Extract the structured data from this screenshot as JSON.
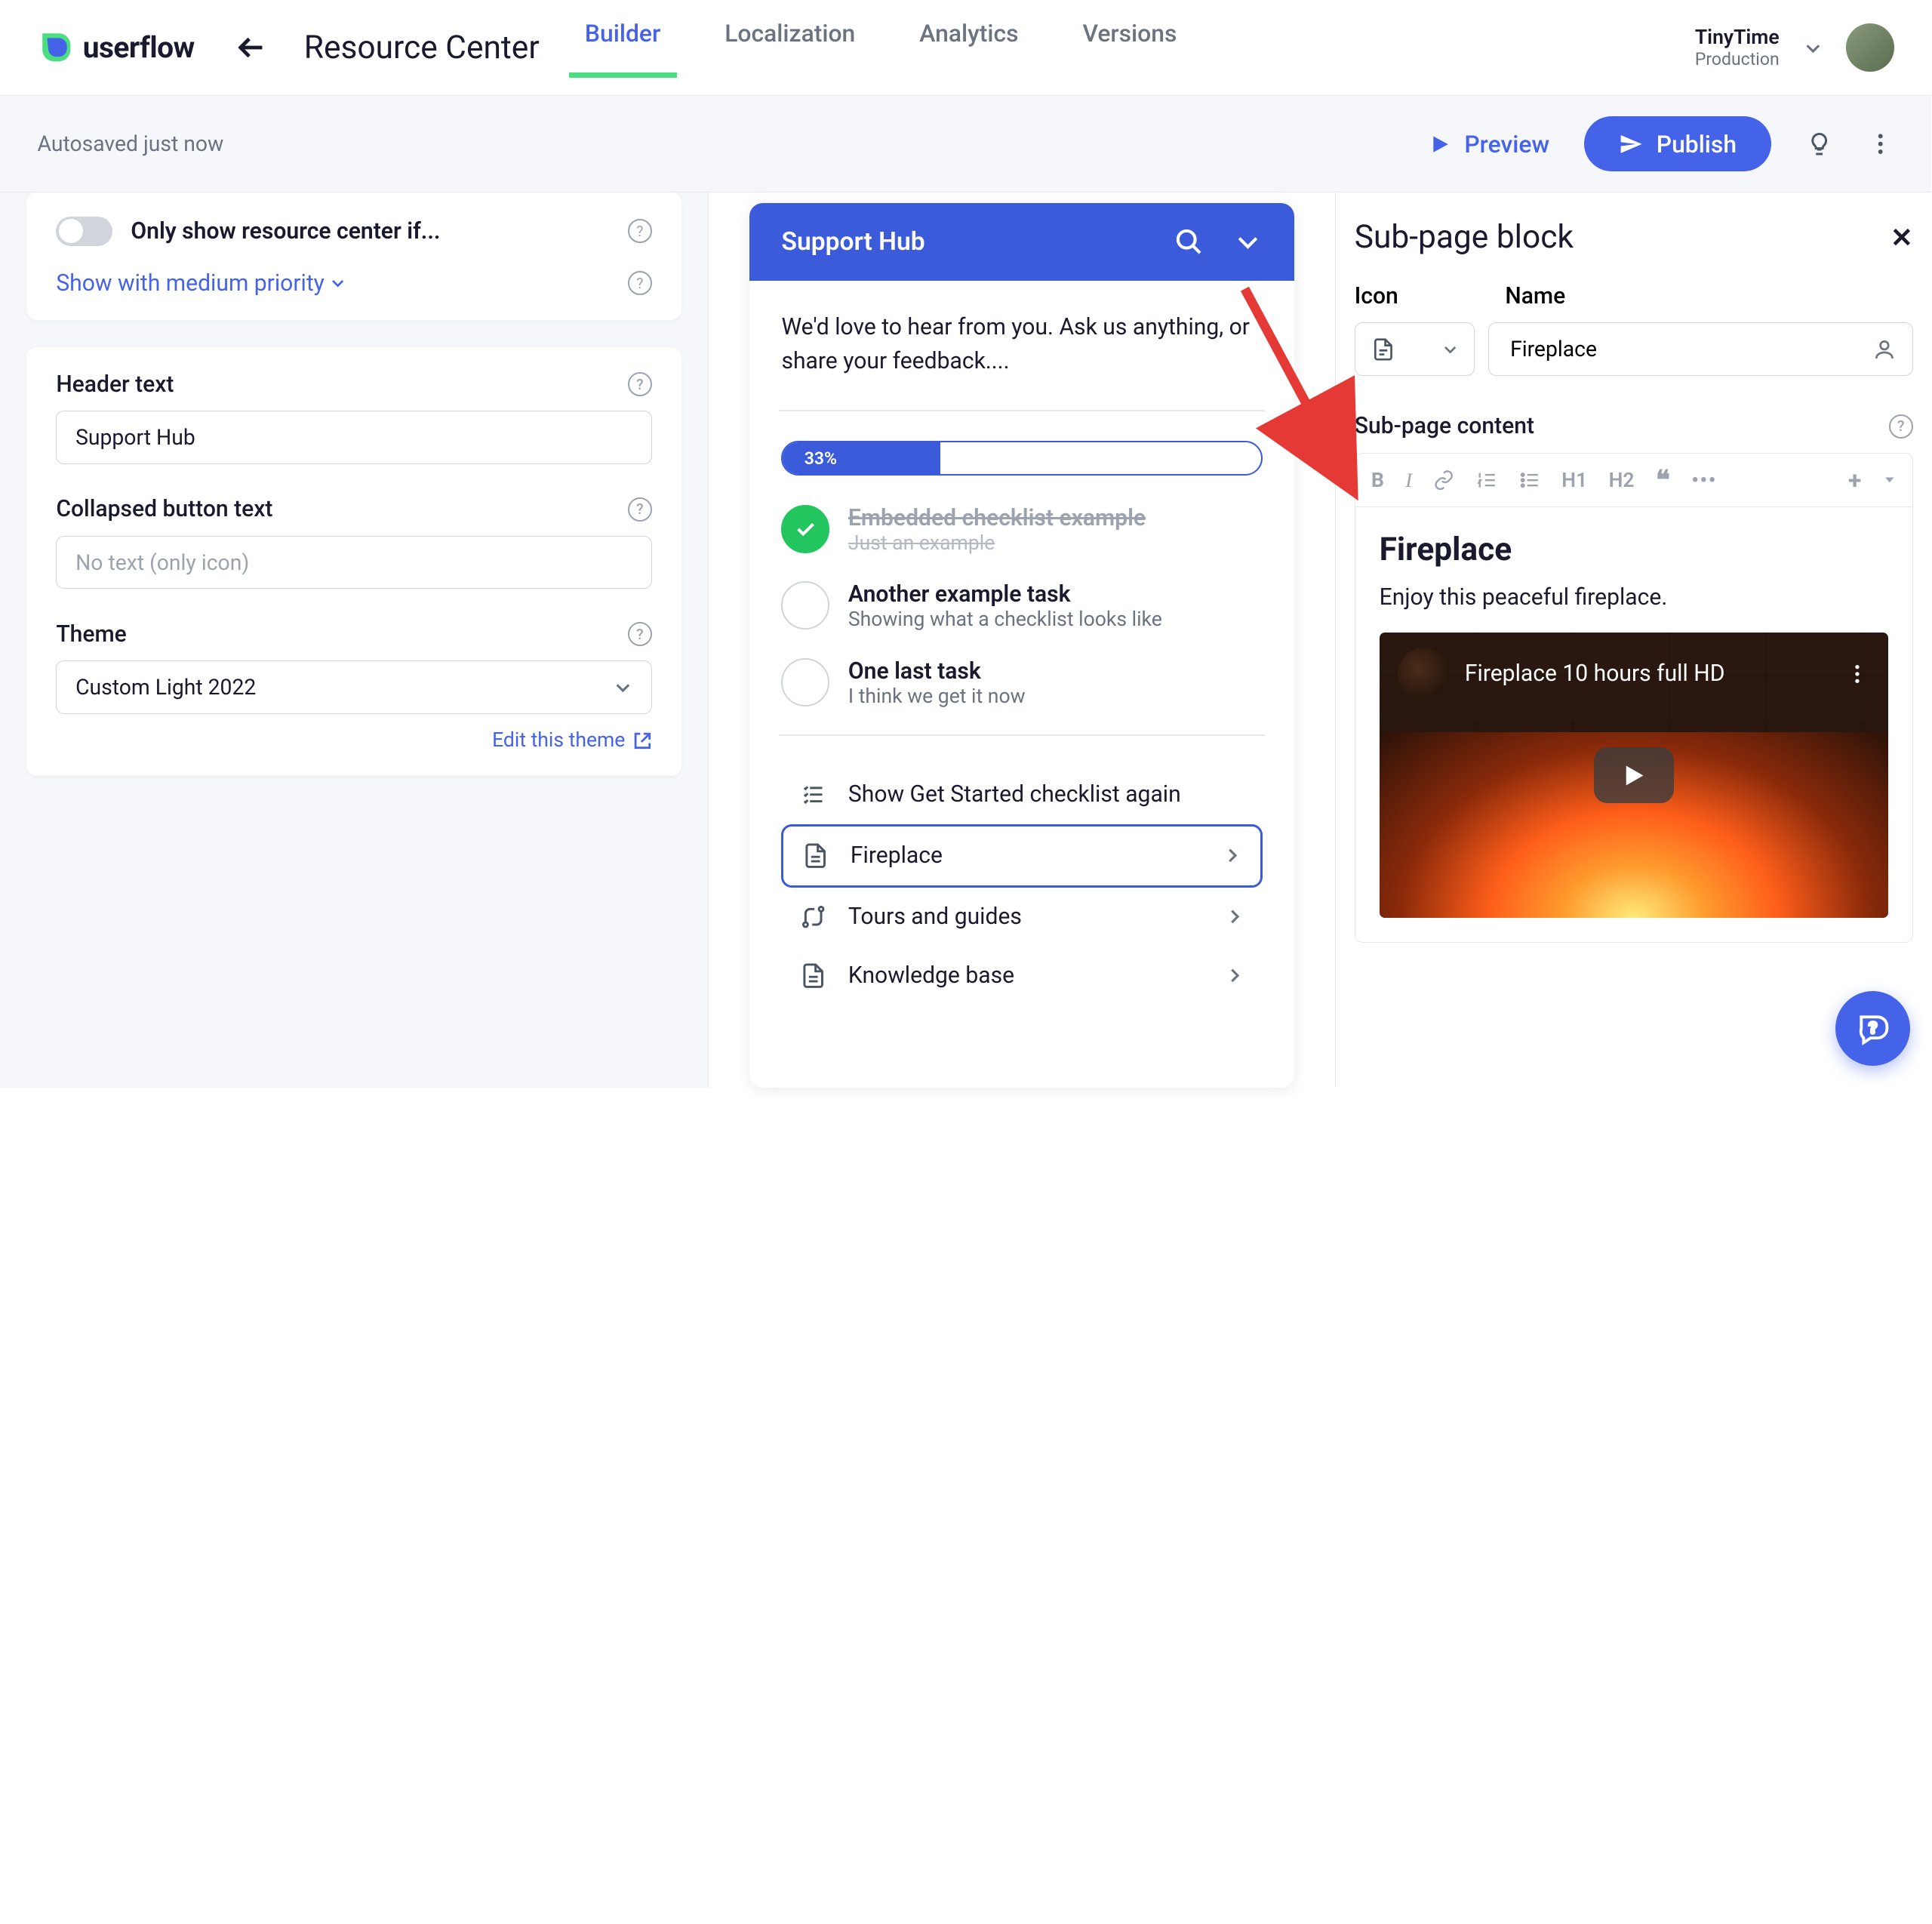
{
  "brand": "userflow",
  "page_title": "Resource Center",
  "tabs": [
    "Builder",
    "Localization",
    "Analytics",
    "Versions"
  ],
  "active_tab": 0,
  "org": {
    "name": "TinyTime",
    "env": "Production"
  },
  "autosave": "Autosaved just now",
  "actions": {
    "preview": "Preview",
    "publish": "Publish"
  },
  "left": {
    "only_show_label": "Only show resource center if...",
    "priority_label": "Show with medium priority",
    "header_text_label": "Header text",
    "header_text_value": "Support Hub",
    "collapsed_label": "Collapsed button text",
    "collapsed_placeholder": "No text (only icon)",
    "theme_label": "Theme",
    "theme_value": "Custom Light 2022",
    "edit_theme": "Edit this theme"
  },
  "widget": {
    "title": "Support Hub",
    "intro": "We'd love to hear from you. Ask us anything, or share your feedback....",
    "progress_pct": "33%",
    "progress_width": 33,
    "tasks": [
      {
        "title": "Embedded checklist example",
        "sub": "Just an example",
        "done": true
      },
      {
        "title": "Another example task",
        "sub": "Showing what a checklist looks like",
        "done": false
      },
      {
        "title": "One last task",
        "sub": "I think we get it now",
        "done": false
      }
    ],
    "nav": [
      {
        "icon": "checklist",
        "label": "Show Get Started checklist again",
        "chevron": false,
        "selected": false
      },
      {
        "icon": "doc",
        "label": "Fireplace",
        "chevron": true,
        "selected": true
      },
      {
        "icon": "route",
        "label": "Tours and guides",
        "chevron": true,
        "selected": false
      },
      {
        "icon": "doc",
        "label": "Knowledge base",
        "chevron": true,
        "selected": false
      }
    ]
  },
  "right": {
    "title": "Sub-page block",
    "icon_label": "Icon",
    "name_label": "Name",
    "name_value": "Fireplace",
    "content_label": "Sub-page content",
    "editor": {
      "heading": "Fireplace",
      "paragraph": "Enjoy this peaceful fireplace.",
      "video_title": "Fireplace 10 hours full HD"
    },
    "toolbar": {
      "h1": "H1",
      "h2": "H2"
    }
  }
}
